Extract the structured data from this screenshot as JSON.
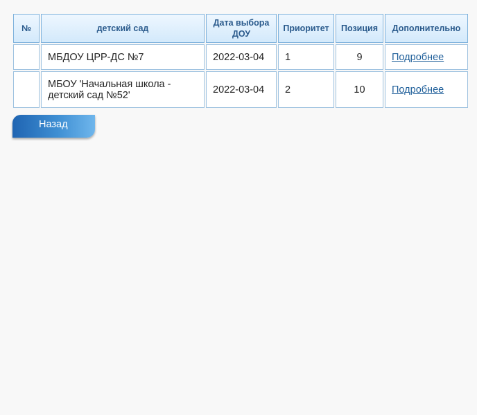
{
  "table": {
    "headers": {
      "num": "№",
      "kindergarten": "детский сад",
      "choice_date": "Дата выбора ДОУ",
      "priority": "Приоритет",
      "position": "Позиция",
      "extra": "Дополнительно"
    },
    "rows": [
      {
        "num": "",
        "kindergarten": "МБДОУ ЦРР-ДС №7",
        "choice_date": "2022-03-04",
        "priority": "1",
        "position": "9",
        "details_link": "Подробнее"
      },
      {
        "num": "",
        "kindergarten": "МБОУ 'Начальная школа - детский сад №52'",
        "choice_date": "2022-03-04",
        "priority": "2",
        "position": "10",
        "details_link": "Подробнее"
      }
    ]
  },
  "actions": {
    "back_label": "Назад"
  },
  "colors": {
    "header_text": "#2a5a8c",
    "header_border": "#7fb2dc",
    "link": "#1f5f9a",
    "button_start": "#1f64b2",
    "button_end": "#6fb6ec",
    "background": "#f8f8f8"
  }
}
